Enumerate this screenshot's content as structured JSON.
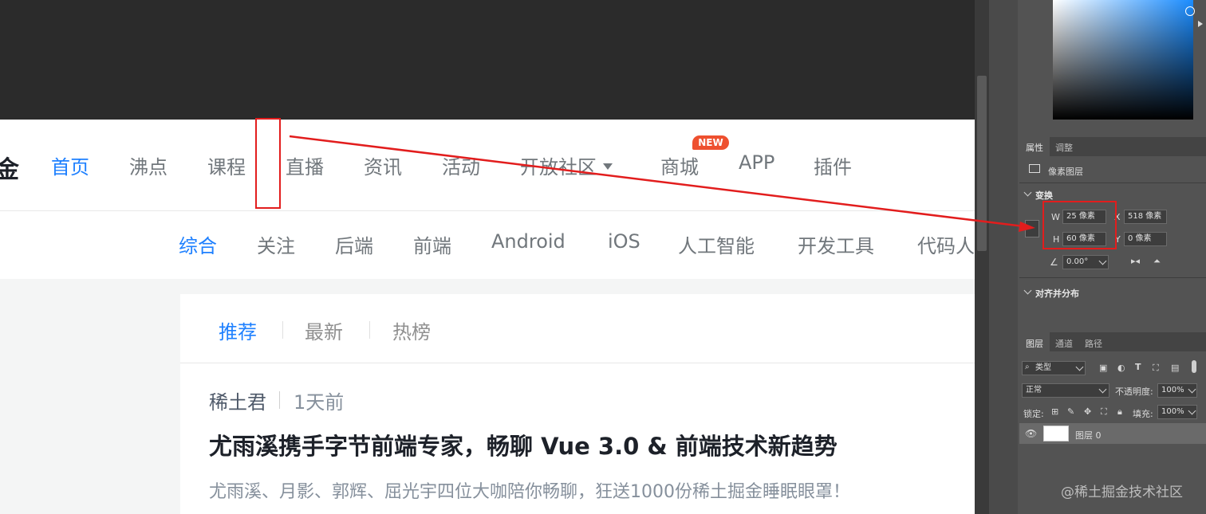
{
  "web": {
    "logo_glyph": "金",
    "nav": [
      {
        "label": "首页",
        "active": true
      },
      {
        "label": "沸点"
      },
      {
        "label": "课程"
      },
      {
        "label": "直播"
      },
      {
        "label": "资讯"
      },
      {
        "label": "活动"
      },
      {
        "label": "开放社区",
        "dropdown": true
      },
      {
        "label": "商城",
        "badge": "NEW"
      },
      {
        "label": "APP"
      },
      {
        "label": "插件"
      }
    ],
    "subnav": [
      {
        "label": "综合",
        "active": true
      },
      {
        "label": "关注"
      },
      {
        "label": "后端"
      },
      {
        "label": "前端"
      },
      {
        "label": "Android"
      },
      {
        "label": "iOS"
      },
      {
        "label": "人工智能"
      },
      {
        "label": "开发工具"
      },
      {
        "label": "代码人"
      }
    ],
    "feed_tabs": [
      {
        "label": "推荐",
        "active": true
      },
      {
        "label": "最新"
      },
      {
        "label": "热榜"
      }
    ],
    "article": {
      "author": "稀土君",
      "time": "1天前",
      "title": "尤雨溪携手字节前端专家，畅聊 Vue 3.0 & 前端技术新趋势",
      "abstract": "尤雨溪、月影、郭辉、屈光宇四位大咖陪你畅聊，狂送1000份稀土掘金睡眠眼罩！"
    }
  },
  "ps": {
    "props_tabs": [
      "属性",
      "调整"
    ],
    "layer_type": "像素图层",
    "transform_title": "变换",
    "w_label": "W",
    "w_value": "25 像素",
    "h_label": "H",
    "h_value": "60 像素",
    "x_label": "X",
    "x_value": "518 像素",
    "y_label": "Y",
    "y_value": "0 像素",
    "angle_value": "0.00°",
    "align_title": "对齐并分布",
    "layer_tabs": [
      "图层",
      "通道",
      "路径"
    ],
    "filter_kind": "类型",
    "blend_mode": "正常",
    "opacity_label": "不透明度:",
    "opacity_value": "100%",
    "lock_label": "锁定:",
    "fill_label": "填充:",
    "fill_value": "100%",
    "layer_name": "图层 0"
  },
  "watermark": "@稀土掘金技术社区",
  "colors": {
    "accent_blue": "#1e80ff",
    "annotation_red": "#e21d1d",
    "badge_red": "#ee502f",
    "ps_panel": "#535353"
  }
}
